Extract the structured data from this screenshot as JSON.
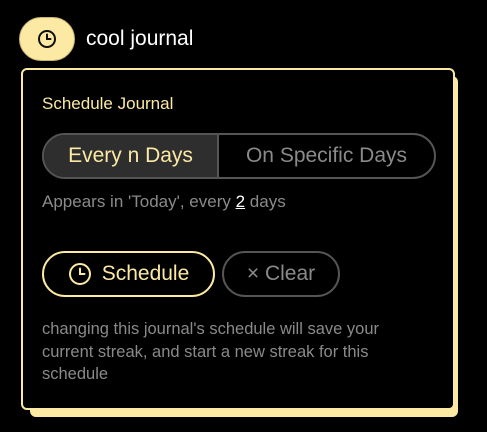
{
  "header": {
    "title": "cool journal",
    "clock_icon": "clock-icon"
  },
  "panel": {
    "heading": "Schedule Journal",
    "tabs": [
      {
        "label": "Every n Days",
        "active": true
      },
      {
        "label": "On Specific Days",
        "active": false
      }
    ],
    "description": {
      "prefix": "Appears in 'Today', every ",
      "value": "2",
      "suffix": " days"
    },
    "schedule_button": {
      "label": "Schedule",
      "icon": "clock-icon"
    },
    "clear_button": {
      "label": "× Clear"
    },
    "note": "changing this journal's schedule will save your current streak, and start a new streak for this schedule"
  },
  "colors": {
    "accent": "#fbe9a4",
    "background": "#000000",
    "muted": "#8a8a8a"
  }
}
